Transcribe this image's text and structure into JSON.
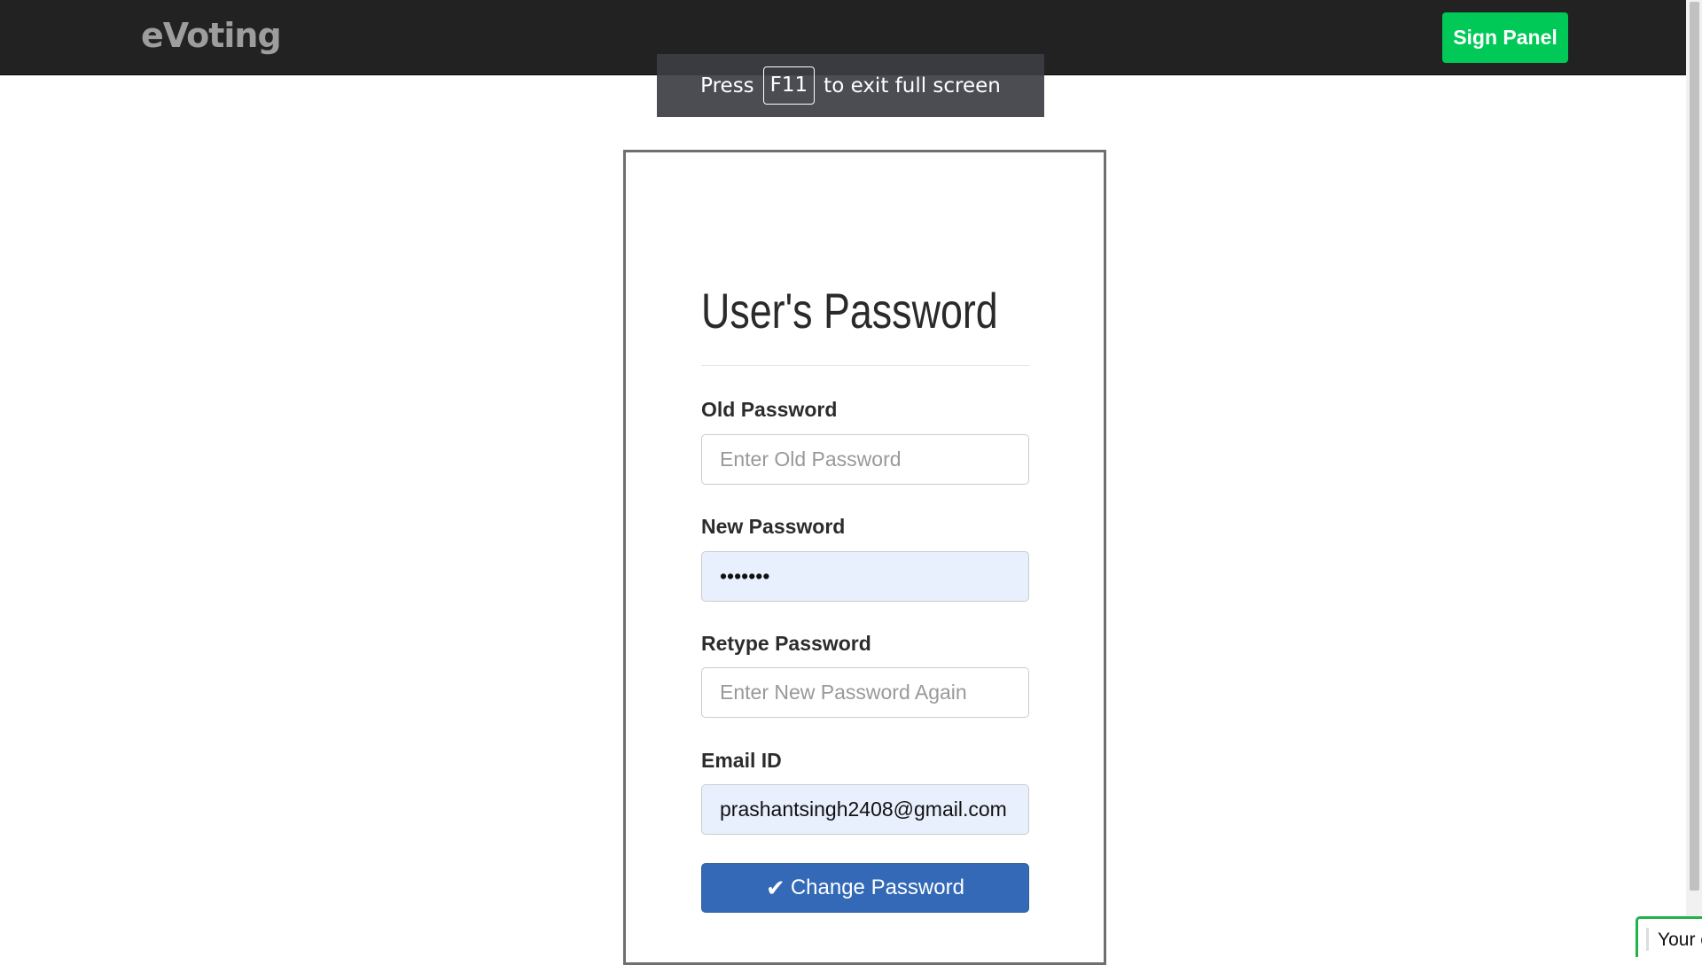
{
  "navbar": {
    "brand": "eVoting",
    "sign_panel_label": "Sign Panel"
  },
  "fullscreen_toast": {
    "prefix": "Press",
    "key": "F11",
    "suffix": "to exit full screen"
  },
  "form": {
    "title": "User's Password",
    "old_password": {
      "label": "Old Password",
      "placeholder": "Enter Old Password",
      "value": ""
    },
    "new_password": {
      "label": "New Password",
      "value": "abcdefg"
    },
    "retype_password": {
      "label": "Retype Password",
      "placeholder": "Enter New Password Again",
      "value": ""
    },
    "email": {
      "label": "Email ID",
      "value": "prashantsingh2408@gmail.com"
    },
    "submit_label": "Change Password",
    "submit_icon": "check-icon"
  },
  "corner_notification": {
    "text": "Your c"
  },
  "colors": {
    "navbar_bg": "#222222",
    "brand_text": "#9d9d9d",
    "sign_panel_bg": "#00c957",
    "submit_bg": "#3369b7",
    "autofill_bg": "#e8f0fe",
    "notification_border": "#22b14c"
  }
}
